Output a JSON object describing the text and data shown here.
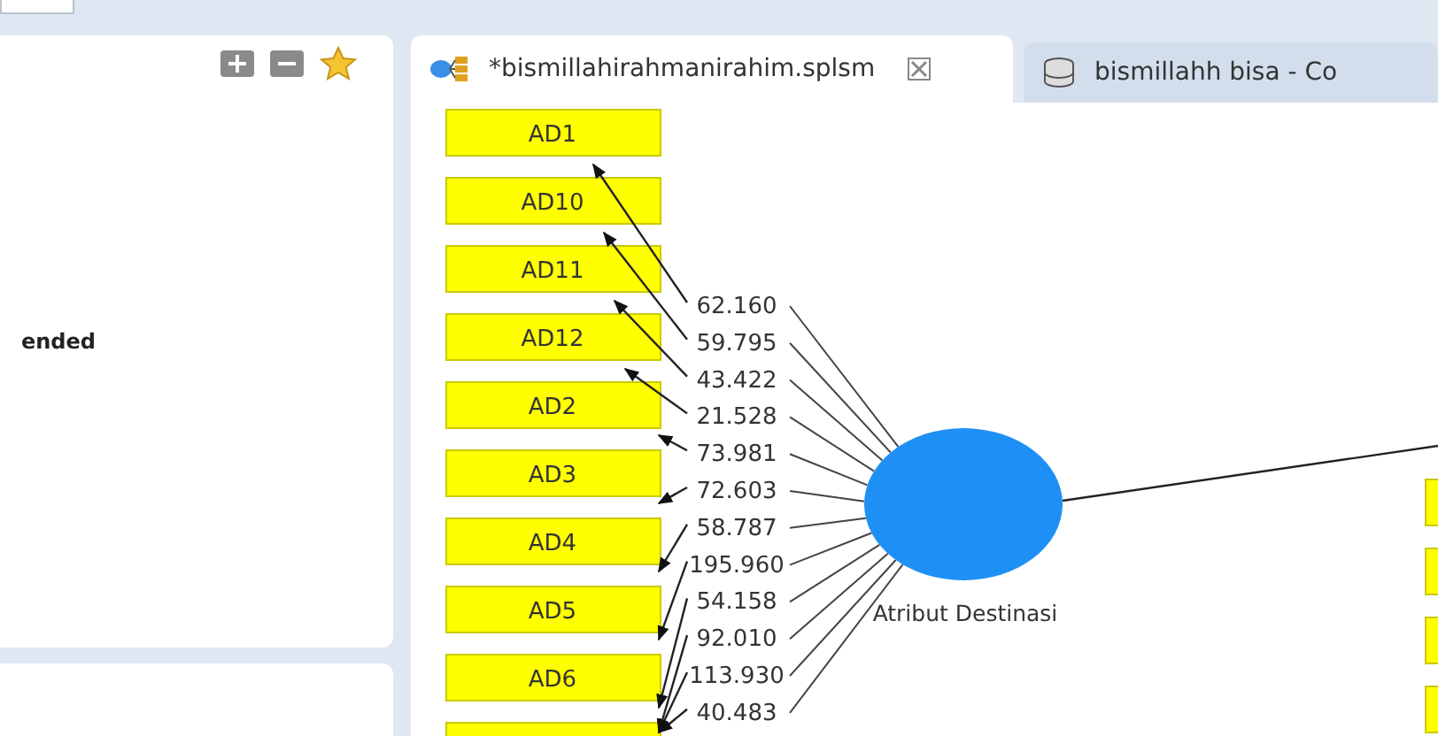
{
  "left_panel": {
    "text": "ended"
  },
  "tabs": [
    {
      "label": "*bismillahirahmanirahim.splsm",
      "selected": true,
      "kind": "model",
      "closable": true
    },
    {
      "label": "bismillahh bisa - Co",
      "selected": false,
      "kind": "data"
    }
  ],
  "diagram": {
    "construct": {
      "label": "Atribut Destinasi"
    },
    "indicators": [
      {
        "kind": "indicator",
        "label": "AD1"
      },
      {
        "kind": "indicator",
        "label": "AD10"
      },
      {
        "kind": "indicator",
        "label": "AD11"
      },
      {
        "kind": "indicator",
        "label": "AD12"
      },
      {
        "kind": "indicator",
        "label": "AD2"
      },
      {
        "kind": "indicator",
        "label": "AD3"
      },
      {
        "kind": "indicator",
        "label": "AD4"
      },
      {
        "kind": "indicator",
        "label": "AD5"
      },
      {
        "kind": "indicator",
        "label": "AD6"
      },
      {
        "kind": "indicator"
      }
    ],
    "loadings": [
      "62.160",
      "59.795",
      "43.422",
      "21.528",
      "73.981",
      "72.603",
      "58.787",
      "195.960",
      "54.158",
      "92.010",
      "113.930",
      "40.483"
    ],
    "right_indicators": [
      {
        "kind": "indicator"
      },
      {
        "kind": "indicator"
      },
      {
        "kind": "indicator"
      },
      {
        "kind": "indicator"
      }
    ]
  }
}
